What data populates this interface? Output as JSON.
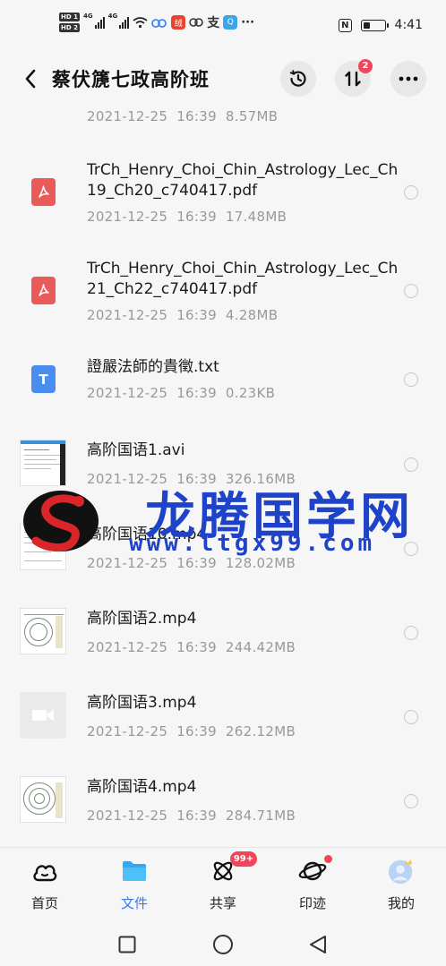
{
  "status_bar": {
    "hd1": "HD 1",
    "hd2": "HD 2",
    "net1": "4G",
    "net2": "4G",
    "app_badge": "绒",
    "alipay": "支",
    "more": "···",
    "nfc": "N",
    "time": "4:41",
    "battery_level": 0.3
  },
  "header": {
    "title": "蔡伏篪七政高阶班",
    "transfer_badge": "2",
    "icons": [
      "back-arrow-icon",
      "history-icon",
      "transfer-icon",
      "more-icon"
    ]
  },
  "files": [
    {
      "name": "",
      "date": "2021-12-25",
      "time": "16:39",
      "size": "8.57MB",
      "type": "pdf"
    },
    {
      "name": "TrCh_Henry_Choi_Chin_Astrology_Lec_Ch19_Ch20_c740417.pdf",
      "date": "2021-12-25",
      "time": "16:39",
      "size": "17.48MB",
      "type": "pdf"
    },
    {
      "name": "TrCh_Henry_Choi_Chin_Astrology_Lec_Ch21_Ch22_c740417.pdf",
      "date": "2021-12-25",
      "time": "16:39",
      "size": "4.28MB",
      "type": "pdf"
    },
    {
      "name": "證嚴法師的貴徵.txt",
      "date": "2021-12-25",
      "time": "16:39",
      "size": "0.23KB",
      "type": "txt"
    },
    {
      "name": "高阶国语1.avi",
      "date": "2021-12-25",
      "time": "16:39",
      "size": "326.16MB",
      "type": "video-doc"
    },
    {
      "name": "高阶国语10.mp4",
      "date": "2021-12-25",
      "time": "16:39",
      "size": "128.02MB",
      "type": "video-doc"
    },
    {
      "name": "高阶国语2.mp4",
      "date": "2021-12-25",
      "time": "16:39",
      "size": "244.42MB",
      "type": "video-chart"
    },
    {
      "name": "高阶国语3.mp4",
      "date": "2021-12-25",
      "time": "16:39",
      "size": "262.12MB",
      "type": "video-blank"
    },
    {
      "name": "高阶国语4.mp4",
      "date": "2021-12-25",
      "time": "16:39",
      "size": "284.71MB",
      "type": "video-chart"
    }
  ],
  "watermark": {
    "text": "龙腾国学网",
    "url": "www.ltgx99.com"
  },
  "bottom_nav": [
    {
      "label": "首页",
      "icon": "home-cloud-icon",
      "active": false
    },
    {
      "label": "文件",
      "icon": "folder-icon",
      "active": true
    },
    {
      "label": "共享",
      "icon": "share-atom-icon",
      "active": false,
      "badge": "99+"
    },
    {
      "label": "印迹",
      "icon": "planet-icon",
      "active": false,
      "dot": true
    },
    {
      "label": "我的",
      "icon": "avatar-icon",
      "active": false
    }
  ],
  "colors": {
    "accent": "#2f7bf5",
    "badge": "#f2455b",
    "pdf": "#ea5a58",
    "txt": "#4a8df0",
    "watermark": "#1f43c8"
  }
}
